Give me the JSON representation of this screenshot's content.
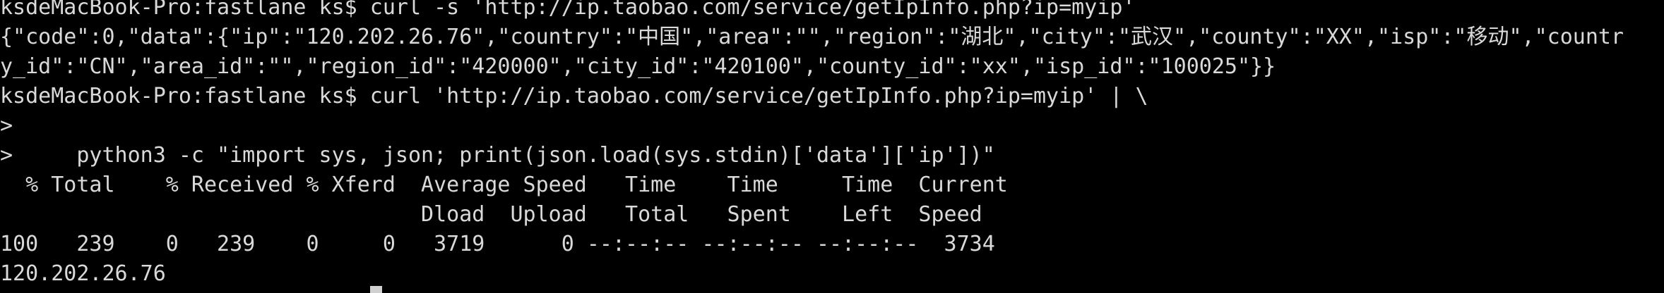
{
  "terminal": {
    "lines": [
      "ksdeMacBook-Pro:fastlane ks$ curl -s 'http://ip.taobao.com/service/getIpInfo.php?ip=myip'",
      "{\"code\":0,\"data\":{\"ip\":\"120.202.26.76\",\"country\":\"中国\",\"area\":\"\",\"region\":\"湖北\",\"city\":\"武汉\",\"county\":\"XX\",\"isp\":\"移动\",\"countr",
      "y_id\":\"CN\",\"area_id\":\"\",\"region_id\":\"420000\",\"city_id\":\"420100\",\"county_id\":\"xx\",\"isp_id\":\"100025\"}}",
      "ksdeMacBook-Pro:fastlane ks$ curl 'http://ip.taobao.com/service/getIpInfo.php?ip=myip' | \\",
      ">",
      ">     python3 -c \"import sys, json; print(json.load(sys.stdin)['data']['ip'])\"",
      "  % Total    % Received % Xferd  Average Speed   Time    Time     Time  Current",
      "                                 Dload  Upload   Total   Spent    Left  Speed",
      "100   239    0   239    0     0   3719      0 --:--:-- --:--:-- --:--:--  3734",
      "120.202.26.76"
    ]
  }
}
